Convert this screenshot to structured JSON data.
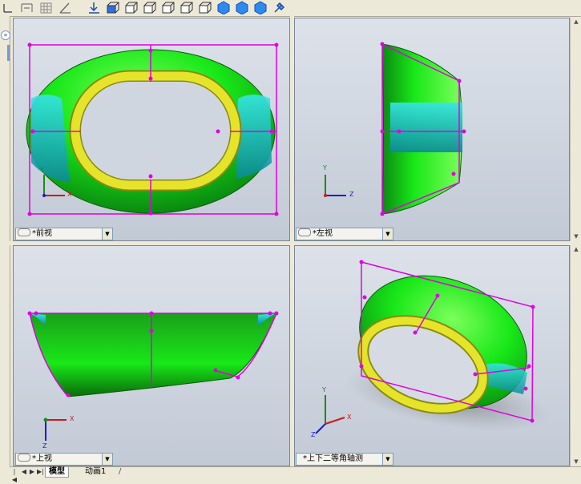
{
  "toolbar": {
    "icons": [
      "dimension-icon",
      "move-dimension-icon",
      "grid-icon",
      "angle-icon",
      "normal-to-icon",
      "front-view-icon",
      "back-view-icon",
      "left-view-icon",
      "right-view-icon",
      "top-view-icon",
      "bottom-view-icon",
      "isometric-view-icon",
      "trimetric-view-icon",
      "dimetric-view-icon",
      "view-selector-icon"
    ]
  },
  "viewports": {
    "front": {
      "label": "*前视"
    },
    "left": {
      "label": "*左视"
    },
    "top": {
      "label": "*上视"
    },
    "iso": {
      "label": "*上下二等角轴测"
    }
  },
  "triad": {
    "x": "X",
    "y": "Y",
    "z": "Z"
  },
  "tabs": {
    "model": "模型",
    "animation": "动画1"
  },
  "colors": {
    "body_green": "#18e818",
    "rim_yellow": "#e6e42a",
    "cyan_face": "#22c8d0",
    "sketch_magenta": "#e000e0",
    "viewport_bg": "#d3d9e2"
  }
}
